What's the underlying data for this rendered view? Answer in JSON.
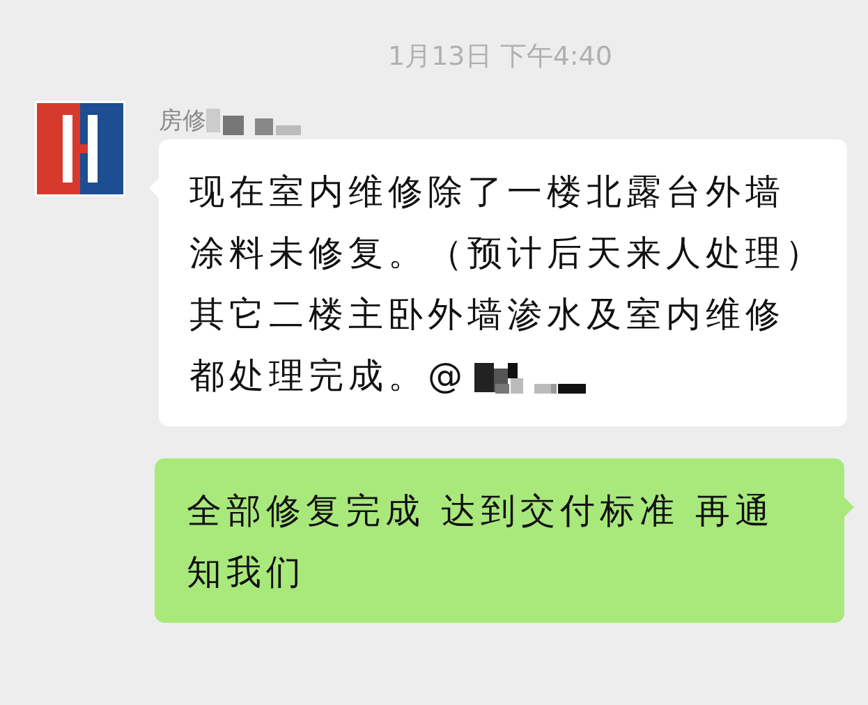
{
  "timestamp": "1月13日 下午4:40",
  "messages": [
    {
      "kind": "incoming",
      "sender": "房修",
      "sender_redacted": true,
      "lines": [
        "现在室内维修除了一楼北露台外墙",
        "涂料未修复。（预计后天来人处理）",
        "其它二楼主卧外墙渗水及室内维修",
        "都处理完成。@"
      ],
      "text_redacted": true
    },
    {
      "kind": "outgoing",
      "lines": [
        "全部修复完成 达到交付标准 再通",
        "知我们"
      ],
      "text_redacted": false
    }
  ]
}
